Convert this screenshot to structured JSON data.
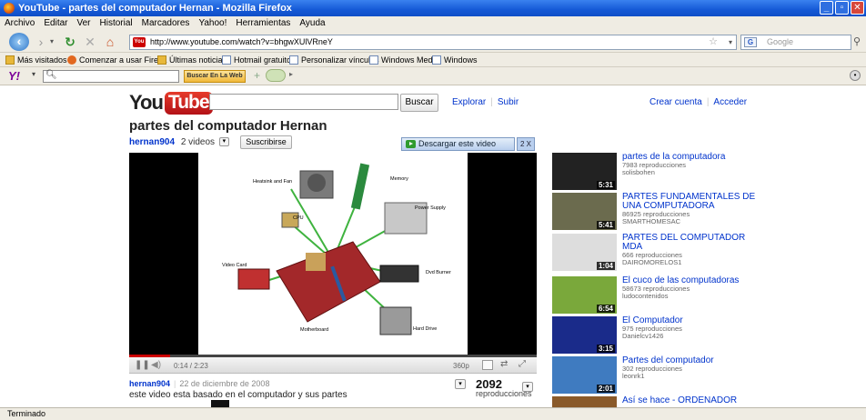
{
  "window": {
    "title": "YouTube - partes del computador  Hernan - Mozilla Firefox"
  },
  "menu": [
    "Archivo",
    "Editar",
    "Ver",
    "Historial",
    "Marcadores",
    "Yahoo!",
    "Herramientas",
    "Ayuda"
  ],
  "nav": {
    "url": "http://www.youtube.com/watch?v=bhgwXUlVRneY",
    "search_placeholder": "Google",
    "search_icon_label": "G"
  },
  "bookmarks": [
    "Más visitados",
    "Comenzar a usar Firef...",
    "Últimas noticias",
    "Hotmail gratuito",
    "Personalizar vínculos",
    "Windows Media",
    "Windows"
  ],
  "yahoo_toolbar": {
    "logo": "Y!",
    "search_button": "Buscar En La Web"
  },
  "youtube": {
    "logo_you": "You",
    "logo_tube": "Tube",
    "search_button": "Buscar",
    "nav": [
      "Explorar",
      "Subir"
    ],
    "account": [
      "Crear cuenta",
      "Acceder"
    ],
    "video_title": "partes del computador Hernan",
    "channel": "hernan904",
    "video_count": "2 videos",
    "subscribe": "Suscribirse",
    "download": "Descargar este video",
    "download_extra": "2 X",
    "player": {
      "time": "0:14 / 2:23",
      "quality": "360p",
      "progress_fraction": 0.1,
      "diagram_labels": [
        "Heatsink and Fan",
        "Memory",
        "CPU",
        "Power Supply",
        "Video Card",
        "Dvd Burner",
        "Motherboard",
        "Hard Drive"
      ]
    },
    "info": {
      "user": "hernan904",
      "date": "22 de diciembre de 2008",
      "description": "este video esta basado en el computador y sus partes",
      "views": "2092",
      "views_label": "reproducciones"
    },
    "related": [
      {
        "title": "partes de la computadora",
        "views": "7983 reproducciones",
        "user": "solisbohen",
        "duration": "5:31",
        "thumb": "#222"
      },
      {
        "title": "PARTES FUNDAMENTALES DE UNA COMPUTADORA",
        "views": "86925 reproducciones",
        "user": "SMARTHOMESAC",
        "duration": "5:41",
        "thumb": "#6b6b4e"
      },
      {
        "title": "PARTES DEL COMPUTADOR MDA",
        "views": "666 reproducciones",
        "user": "DAIROMORELOS1",
        "duration": "1:04",
        "thumb": "#ddd"
      },
      {
        "title": "El cuco de las computadoras",
        "views": "58673 reproducciones",
        "user": "ludocontenidos",
        "duration": "6:54",
        "thumb": "#7aa83b"
      },
      {
        "title": "El Computador",
        "views": "975 reproducciones",
        "user": "Danielcv1426",
        "duration": "3:15",
        "thumb": "#1a2b8a"
      },
      {
        "title": "Partes del computador",
        "views": "302 reproducciones",
        "user": "leonrk1",
        "duration": "2:01",
        "thumb": "#3f7bc0"
      },
      {
        "title": "Así se hace - ORDENADOR",
        "views": "",
        "user": "",
        "duration": "",
        "thumb": "#8a5a2a"
      }
    ]
  },
  "status": "Terminado"
}
